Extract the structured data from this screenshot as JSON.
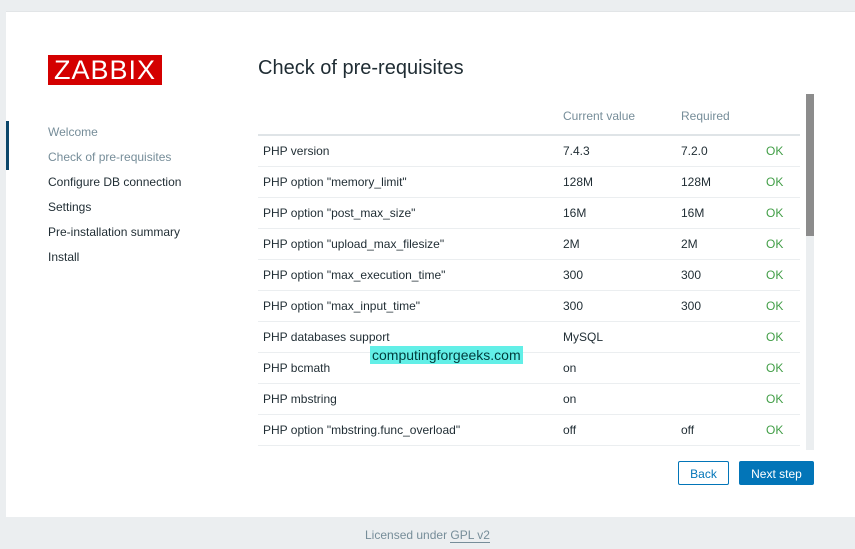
{
  "logo": "ZABBIX",
  "steps": [
    {
      "label": "Welcome",
      "state": "done"
    },
    {
      "label": "Check of pre-requisites",
      "state": "current"
    },
    {
      "label": "Configure DB connection",
      "state": "pending"
    },
    {
      "label": "Settings",
      "state": "pending"
    },
    {
      "label": "Pre-installation summary",
      "state": "pending"
    },
    {
      "label": "Install",
      "state": "pending"
    }
  ],
  "title": "Check of pre-requisites",
  "table": {
    "headers": [
      "",
      "Current value",
      "Required",
      ""
    ],
    "rows": [
      {
        "name": "PHP version",
        "current": "7.4.3",
        "required": "7.2.0",
        "status": "OK"
      },
      {
        "name": "PHP option \"memory_limit\"",
        "current": "128M",
        "required": "128M",
        "status": "OK"
      },
      {
        "name": "PHP option \"post_max_size\"",
        "current": "16M",
        "required": "16M",
        "status": "OK"
      },
      {
        "name": "PHP option \"upload_max_filesize\"",
        "current": "2M",
        "required": "2M",
        "status": "OK"
      },
      {
        "name": "PHP option \"max_execution_time\"",
        "current": "300",
        "required": "300",
        "status": "OK"
      },
      {
        "name": "PHP option \"max_input_time\"",
        "current": "300",
        "required": "300",
        "status": "OK"
      },
      {
        "name": "PHP databases support",
        "current": "MySQL",
        "required": "",
        "status": "OK"
      },
      {
        "name": "PHP bcmath",
        "current": "on",
        "required": "",
        "status": "OK"
      },
      {
        "name": "PHP mbstring",
        "current": "on",
        "required": "",
        "status": "OK"
      },
      {
        "name": "PHP option \"mbstring.func_overload\"",
        "current": "off",
        "required": "off",
        "status": "OK"
      }
    ]
  },
  "watermark": "computingforgeeks.com",
  "buttons": {
    "back": "Back",
    "next": "Next step"
  },
  "footer": {
    "text": "Licensed under ",
    "link": "GPL v2"
  },
  "colors": {
    "brand": "#d40000",
    "accent": "#0275b8",
    "ok": "#429e47"
  }
}
